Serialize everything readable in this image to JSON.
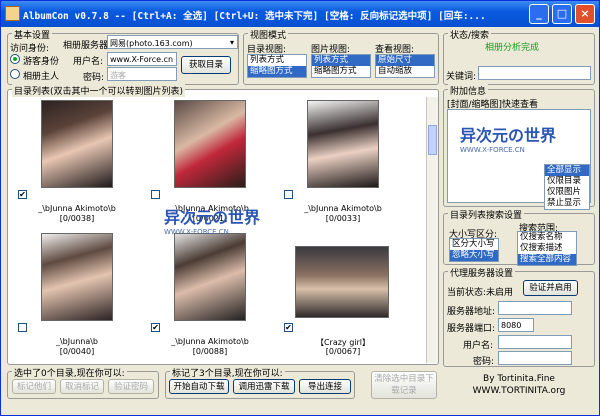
{
  "title": "AlbumCon v0.7.8 -- [Ctrl+A: 全选] [Ctrl+U: 选中未下完] [空格: 反向标记选中项] [回车:...",
  "window_buttons": {
    "minimize": "_",
    "maximize": "□",
    "close": "×"
  },
  "basic": {
    "title": "基本设置",
    "access_label": "访问身份:",
    "guest": "游客身份",
    "owner": "相册主人",
    "server_label": "相册服务器:",
    "server_value": "网易(photo.163.com)",
    "user_label": "用户名:",
    "user_value": "www.X-Force.cn",
    "pass_label": "密码:",
    "pass_placeholder": "游客",
    "get_dir": "获取目录"
  },
  "view": {
    "title": "视图模式",
    "dir_view": "目录视图:",
    "dir_items": [
      "列表方式",
      "缩略图方式"
    ],
    "pic_view": "图片视图:",
    "pic_items": [
      "列表方式",
      "缩略图方式"
    ],
    "see_view": "查看视图:",
    "see_items": [
      "原始尺寸",
      "自动缩放"
    ]
  },
  "status": {
    "title": "状态/搜索",
    "message": "相册分析完成",
    "keyword_label": "关键词:"
  },
  "attach": {
    "title": "附加信息",
    "subtitle": "[封面/缩略图]快速查看",
    "filter_items": [
      "全部显示",
      "仅限目录",
      "仅限图片",
      "禁止显示"
    ]
  },
  "listsearch": {
    "title": "目录列表搜索设置",
    "case_label": "大小写区分:",
    "case_items": [
      "区分大小写",
      "忽略大小写"
    ],
    "scope_label": "搜索范围:",
    "scope_items": [
      "仅搜索名称",
      "仅搜索描述",
      "搜索全部内容"
    ]
  },
  "proxy": {
    "title": "代理服务器设置",
    "state_label": "当前状态:未启用",
    "verify": "验证并启用",
    "addr_label": "服务器地址:",
    "port_label": "服务器端口:",
    "port_value": "8080",
    "user_label": "用户名:",
    "pass_label": "密码:"
  },
  "dirlist": {
    "title": "目录列表(双击其中一个可以转到图片列表)",
    "items": [
      {
        "caption": "_\\bJunna Akimoto\\b",
        "count": "[0/0038]",
        "checked": true
      },
      {
        "caption": "_\\bJunna Akimoto\\b",
        "count": "[0/0021]",
        "checked": false
      },
      {
        "caption": "_\\bJunna Akimoto\\b",
        "count": "[0/0033]",
        "checked": false
      },
      {
        "caption": "_\\bJunna\\b",
        "count": "[0/0040]",
        "checked": false
      },
      {
        "caption": "_\\bJunna Akimoto\\b",
        "count": "[0/0088]",
        "checked": true
      },
      {
        "caption": "【Crazy girl】",
        "count": "[0/0067]",
        "checked": true
      }
    ]
  },
  "bottom": {
    "sel_dirs": "选中了0个目录,现在你可以:",
    "mark_them": "标记他们",
    "unmark": "取消标记",
    "verify_pwd": "验证密码",
    "sel_pics": "标记了3个目录,现在你可以:",
    "start_dl": "开始自动下载",
    "thunder": "调用迅雷下载",
    "export": "导出连接",
    "clear_rec": "清除选中目录下载记录"
  },
  "watermark": {
    "main": "异次元の世界",
    "sub": "WWW.X-FORCE.CN"
  },
  "credit": {
    "line1": "By Tortinita.Fine",
    "line2": "WWW.TORTINITA.org"
  }
}
